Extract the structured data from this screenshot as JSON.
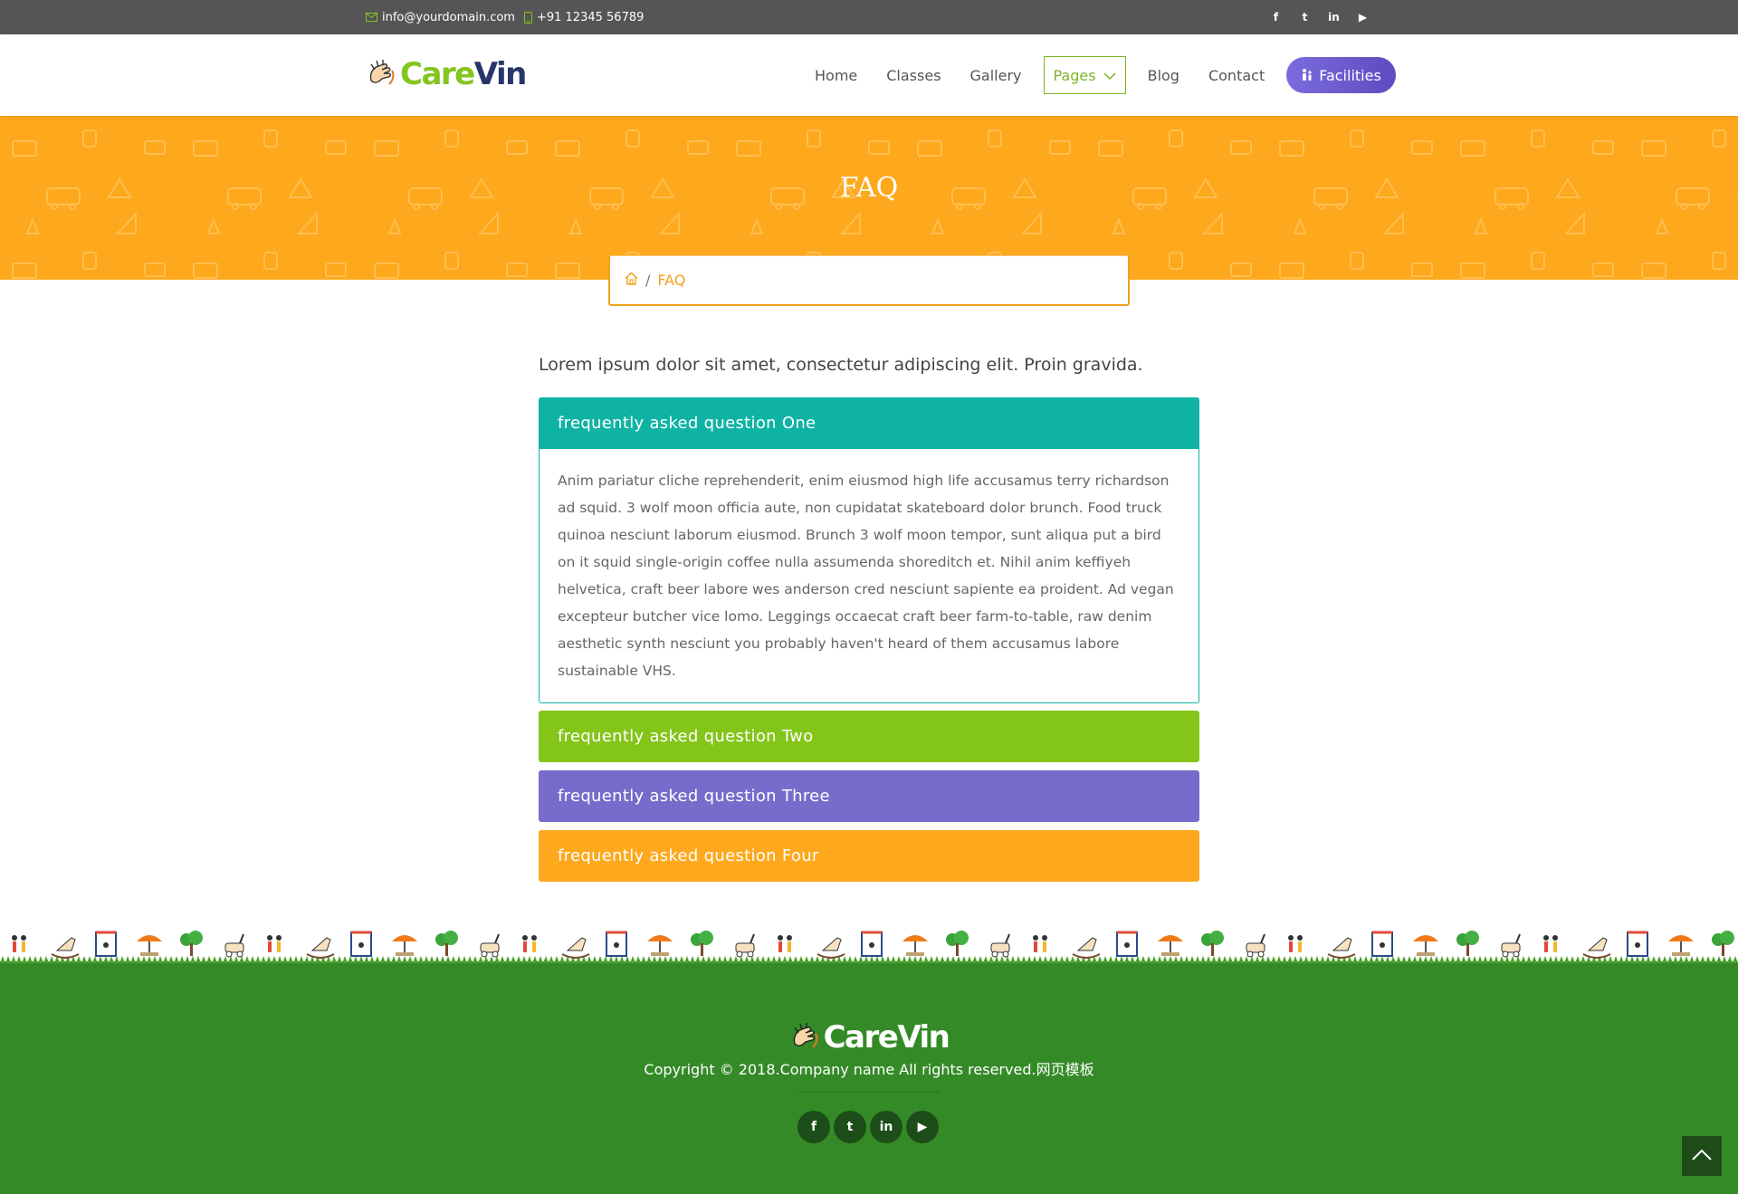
{
  "topbar": {
    "email": "info@yourdomain.com",
    "phone": "+91 12345 56789",
    "social": [
      "facebook",
      "twitter",
      "linkedin",
      "youtube"
    ],
    "social_glyphs": [
      "f",
      "t",
      "in",
      "▶"
    ]
  },
  "header": {
    "logo_part1": "Care",
    "logo_part2": "Vin",
    "nav": {
      "home": "Home",
      "classes": "Classes",
      "gallery": "Gallery",
      "pages": "Pages",
      "blog": "Blog",
      "contact": "Contact",
      "facilities": "Facilities"
    }
  },
  "banner": {
    "title": "FAQ",
    "breadcrumb_current": "FAQ",
    "breadcrumb_sep": "/"
  },
  "main": {
    "intro": "Lorem ipsum dolor sit amet, consectetur adipiscing elit. Proin gravida.",
    "faqs": [
      {
        "question": "frequently asked question One",
        "answer": "Anim pariatur cliche reprehenderit, enim eiusmod high life accusamus terry richardson ad squid. 3 wolf moon officia aute, non cupidatat skateboard dolor brunch. Food truck quinoa nesciunt laborum eiusmod. Brunch 3 wolf moon tempor, sunt aliqua put a bird on it squid single-origin coffee nulla assumenda shoreditch et. Nihil anim keffiyeh helvetica, craft beer labore wes anderson cred nesciunt sapiente ea proident. Ad vegan excepteur butcher vice lomo. Leggings occaecat craft beer farm-to-table, raw denim aesthetic synth nesciunt you probably haven't heard of them accusamus labore sustainable VHS.",
        "color": "#0fb3a4"
      },
      {
        "question": "frequently asked question Two",
        "color": "#84c51a"
      },
      {
        "question": "frequently asked question Three",
        "color": "#766ccb"
      },
      {
        "question": "frequently asked question Four",
        "color": "#fea81d"
      }
    ]
  },
  "footer": {
    "logo": "CareVin",
    "copyright": "Copyright © 2018.Company name All rights reserved.网页模板",
    "social_glyphs": [
      "f",
      "t",
      "in",
      "▶"
    ]
  },
  "colors": {
    "topbar": "#555555",
    "accent_green": "#84c520",
    "brand_navy": "#27366b",
    "banner_orange": "#fea81d",
    "footer_green": "#348a27",
    "facilities_purple": "#6e5fd0"
  }
}
